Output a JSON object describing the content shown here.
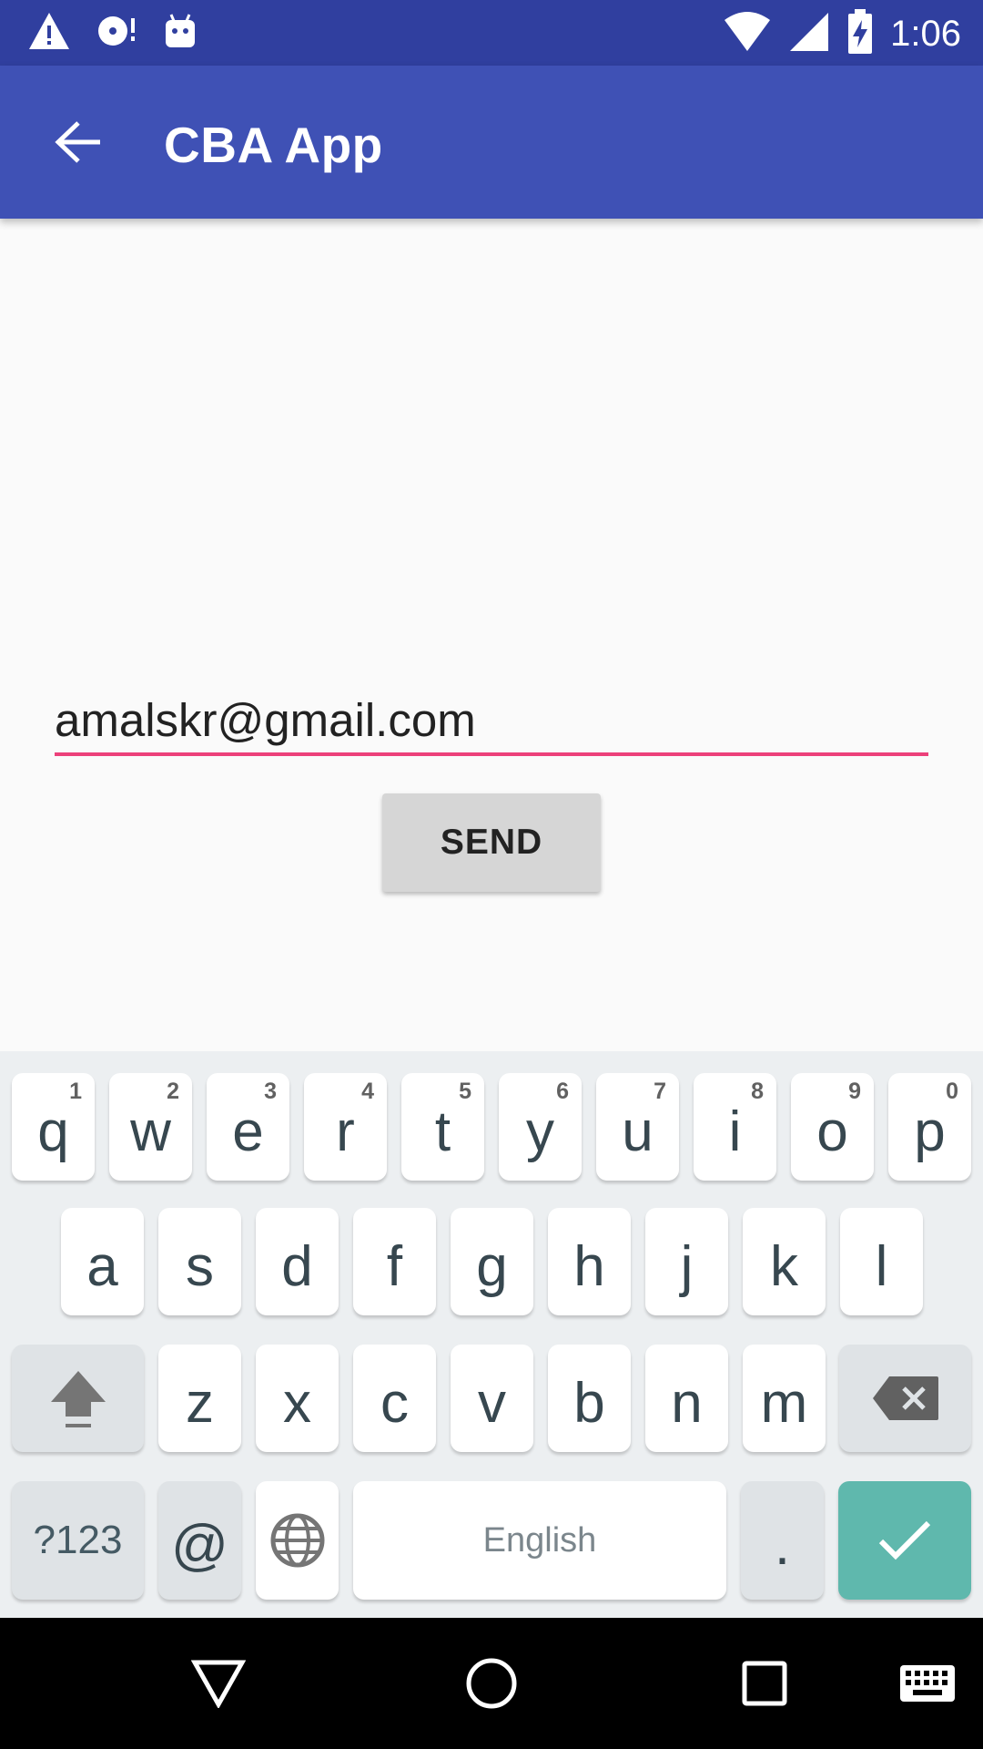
{
  "status_bar": {
    "time": "1:06",
    "icons_left": [
      "warning-icon",
      "disc-icon",
      "android-icon"
    ],
    "icons_right": [
      "wifi-icon",
      "cell-signal-icon",
      "battery-charging-icon"
    ]
  },
  "app_bar": {
    "title": "CBA App",
    "back_icon": "arrow-back-icon",
    "color": "#3f51b5"
  },
  "form": {
    "email_value": "amalskr@gmail.com",
    "send_label": "SEND",
    "accent_color": "#ec407a"
  },
  "keyboard": {
    "row1": [
      {
        "k": "q",
        "n": "1"
      },
      {
        "k": "w",
        "n": "2"
      },
      {
        "k": "e",
        "n": "3"
      },
      {
        "k": "r",
        "n": "4"
      },
      {
        "k": "t",
        "n": "5"
      },
      {
        "k": "y",
        "n": "6"
      },
      {
        "k": "u",
        "n": "7"
      },
      {
        "k": "i",
        "n": "8"
      },
      {
        "k": "o",
        "n": "9"
      },
      {
        "k": "p",
        "n": "0"
      }
    ],
    "row2": [
      "a",
      "s",
      "d",
      "f",
      "g",
      "h",
      "j",
      "k",
      "l"
    ],
    "row3": [
      "z",
      "x",
      "c",
      "v",
      "b",
      "n",
      "m"
    ],
    "symbols_label": "?123",
    "at_label": "@",
    "space_label": "English",
    "period_label": ".",
    "enter_color": "#5fb8ad"
  },
  "nav_bar": {
    "icons": [
      "back-triangle-icon",
      "home-circle-icon",
      "recents-square-icon",
      "keyboard-switch-icon"
    ]
  }
}
